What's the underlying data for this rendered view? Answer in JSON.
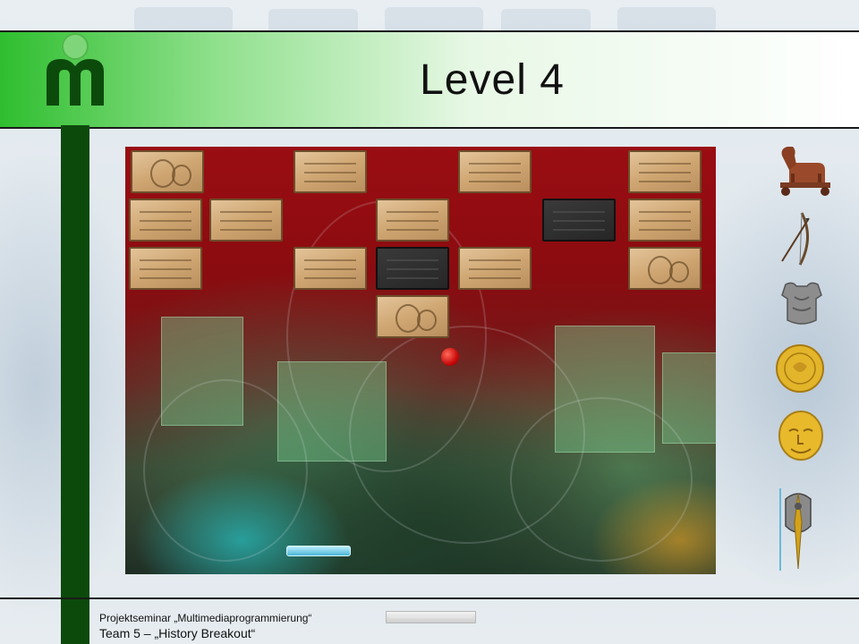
{
  "slide": {
    "title": "Level 4"
  },
  "game": {
    "bricks": [
      {
        "style": "relief"
      },
      {
        "style": "plain"
      },
      {
        "style": "plain"
      },
      {
        "style": "plain"
      },
      {
        "style": "plain"
      },
      {
        "style": "plain"
      },
      {
        "style": "plain"
      },
      {
        "style": "dark"
      },
      {
        "style": "plain"
      },
      {
        "style": "plain"
      },
      {
        "style": "plain"
      },
      {
        "style": "dark"
      },
      {
        "style": "plain"
      },
      {
        "style": "relief"
      },
      {
        "style": "relief"
      }
    ],
    "ball_color": "#c80a0a",
    "paddle_color": "#4ab6d6"
  },
  "artifacts": [
    {
      "name": "trojan-horse-icon"
    },
    {
      "name": "bow-icon"
    },
    {
      "name": "armor-icon"
    },
    {
      "name": "gold-coin-icon"
    },
    {
      "name": "gold-mask-icon"
    },
    {
      "name": "shield-sword-icon"
    }
  ],
  "footer": {
    "seminar": "Projektseminar „Multimediaprogrammierung“",
    "team": "Team 5 – „History Breakout“"
  },
  "colors": {
    "accent_green": "#2fbe2f",
    "pillar_green": "#0c4a0c",
    "game_red": "#9a0d12"
  }
}
